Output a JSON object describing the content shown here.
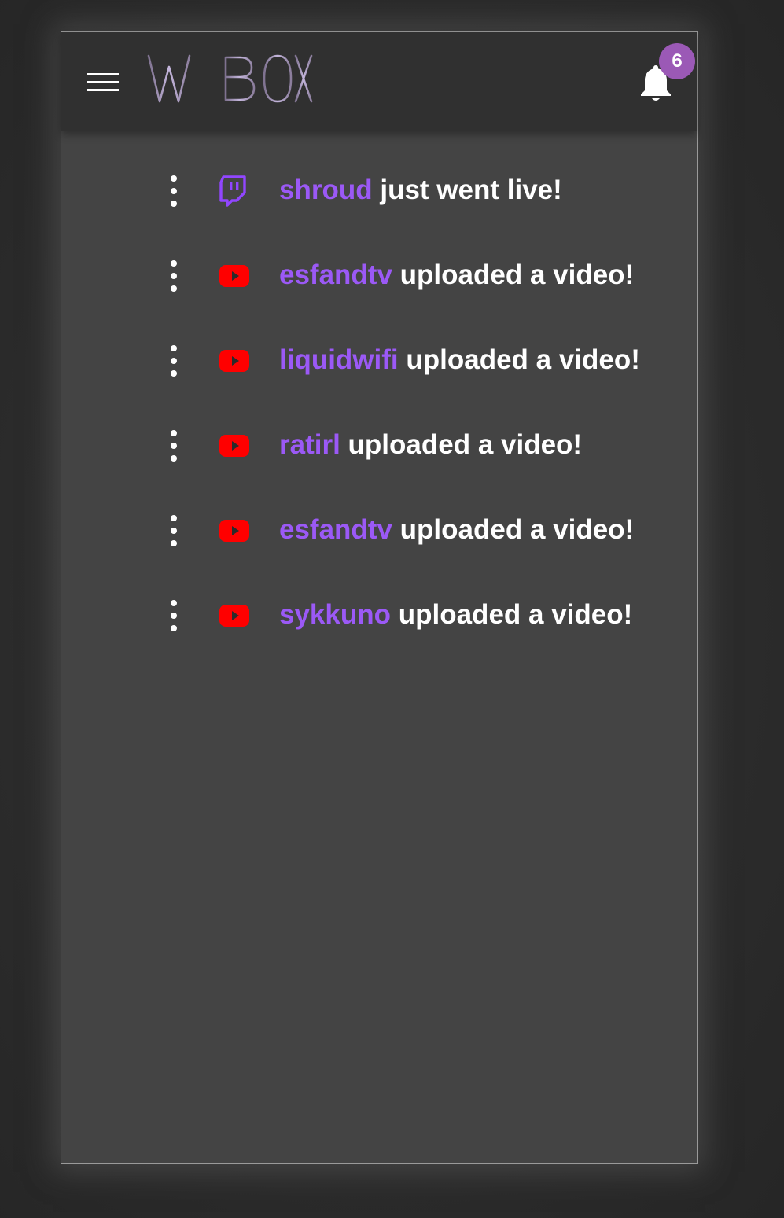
{
  "app": {
    "logo_text": "WEBOX"
  },
  "notifications": {
    "count": "6"
  },
  "colors": {
    "accent": "#9b59f6",
    "badge": "#9b59b6",
    "twitch": "#9146ff",
    "youtube": "#ff0000",
    "panel": "#444444",
    "header": "#303030"
  },
  "feed": [
    {
      "source_icon": "twitch-icon",
      "channel": "shroud",
      "action": "just went live!"
    },
    {
      "source_icon": "youtube-icon",
      "channel": "esfandtv",
      "action": "uploaded a video!"
    },
    {
      "source_icon": "youtube-icon",
      "channel": "liquidwifi",
      "action": "uploaded a video!"
    },
    {
      "source_icon": "youtube-icon",
      "channel": "ratirl",
      "action": "uploaded a video!"
    },
    {
      "source_icon": "youtube-icon",
      "channel": "esfandtv",
      "action": "uploaded a video!"
    },
    {
      "source_icon": "youtube-icon",
      "channel": "sykkuno",
      "action": "uploaded a video!"
    }
  ]
}
